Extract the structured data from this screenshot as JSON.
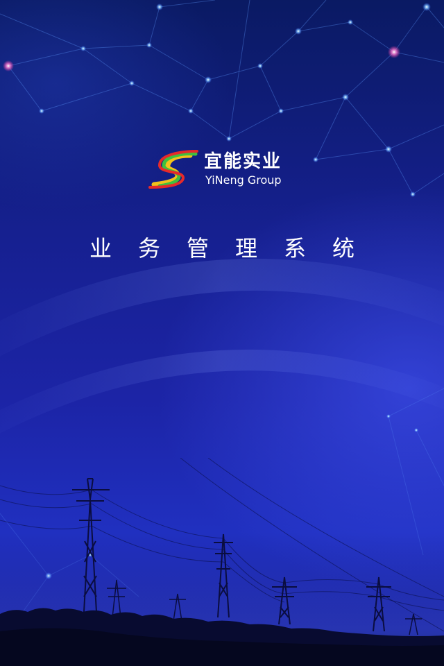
{
  "brand": {
    "name_cn": "宜能实业",
    "name_en": "YiNeng Group",
    "logo_colors": {
      "red": "#e62a2a",
      "green": "#3fbf3f",
      "yellow": "#f2c21b"
    }
  },
  "title": "业务管理系统",
  "theme": {
    "background": "#1c24a6",
    "accent": "#6fb8ff",
    "text": "#ffffff"
  },
  "decorations": {
    "network": "network-lines-icon",
    "landscape": "power-transmission-towers"
  }
}
